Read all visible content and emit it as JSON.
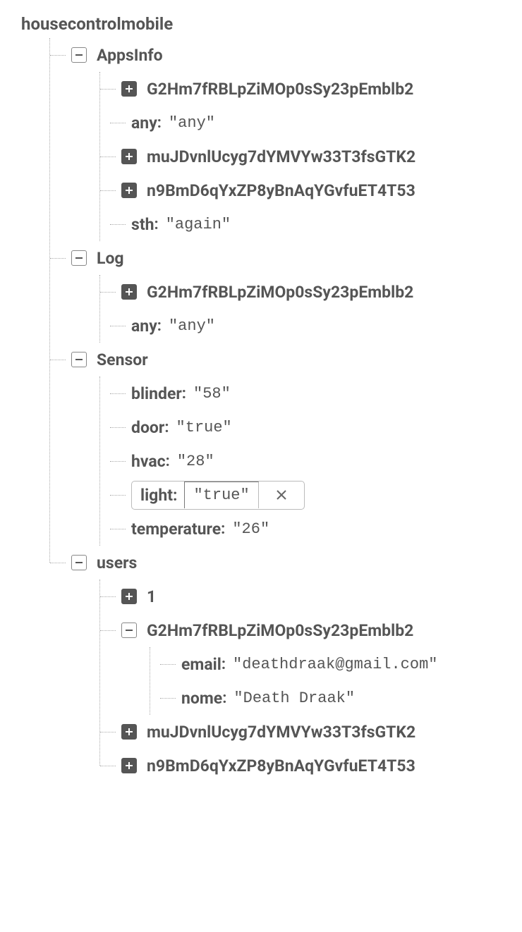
{
  "root": "housecontrolmobile",
  "appsInfo": {
    "label": "AppsInfo",
    "item0": {
      "label": "G2Hm7fRBLpZiMOp0sSy23pEmblb2"
    },
    "leaf0": {
      "key": "any",
      "value": "\"any\""
    },
    "item1": {
      "label": "muJDvnlUcyg7dYMVYw33T3fsGTK2"
    },
    "item2": {
      "label": "n9BmD6qYxZP8yBnAqYGvfuET4T53"
    },
    "leaf1": {
      "key": "sth",
      "value": "\"again\""
    }
  },
  "log": {
    "label": "Log",
    "item0": {
      "label": "G2Hm7fRBLpZiMOp0sSy23pEmblb2"
    },
    "leaf0": {
      "key": "any",
      "value": "\"any\""
    }
  },
  "sensor": {
    "label": "Sensor",
    "blinder": {
      "key": "blinder",
      "value": "\"58\""
    },
    "door": {
      "key": "door",
      "value": "\"true\""
    },
    "hvac": {
      "key": "hvac",
      "value": "\"28\""
    },
    "light": {
      "key": "light",
      "value": "\"true\""
    },
    "temperature": {
      "key": "temperature",
      "value": "\"26\""
    }
  },
  "users": {
    "label": "users",
    "item0": {
      "label": "1"
    },
    "item1": {
      "label": "G2Hm7fRBLpZiMOp0sSy23pEmblb2",
      "email": {
        "key": "email",
        "value": "\"deathdraak@gmail.com\""
      },
      "nome": {
        "key": "nome",
        "value": "\"Death Draak\""
      }
    },
    "item2": {
      "label": "muJDvnlUcyg7dYMVYw33T3fsGTK2"
    },
    "item3": {
      "label": "n9BmD6qYxZP8yBnAqYGvfuET4T53"
    }
  }
}
